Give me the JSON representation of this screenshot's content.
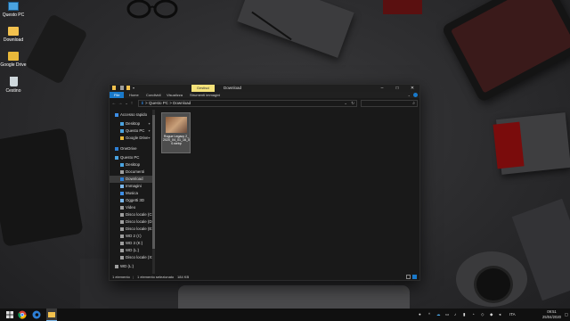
{
  "desktop": {
    "icons": [
      {
        "label": "Questo PC",
        "icon": "computer-icon"
      },
      {
        "label": "Download",
        "icon": "folder-icon"
      },
      {
        "label": "Google Drive",
        "icon": "google-drive-icon"
      },
      {
        "label": "Cestino",
        "icon": "recycle-bin-icon"
      }
    ]
  },
  "window": {
    "title": "Download",
    "context_tab": "Gestisci",
    "ribbon_tabs": [
      "File",
      "Home",
      "Condividi",
      "Visualizza",
      "Strumenti immagini"
    ],
    "address": {
      "parts": [
        "Questo PC",
        "Download"
      ],
      "separator": ">"
    },
    "nav": {
      "items": [
        {
          "label": "Accesso rapido",
          "icon": "star-icon",
          "color": "#3d8ee6",
          "pinned": false
        },
        {
          "label": "Desktop",
          "icon": "desktop-folder-icon",
          "color": "#4aa3e0",
          "pinned": true
        },
        {
          "label": "Questo PC",
          "icon": "computer-icon",
          "color": "#4aa3e0",
          "pinned": true
        },
        {
          "label": "Google Drive",
          "icon": "google-drive-icon",
          "color": "#e8b83a",
          "pinned": true
        },
        {
          "label": "OneDrive",
          "icon": "cloud-icon",
          "color": "#2d7fd6",
          "pinned": false
        },
        {
          "label": "Questo PC",
          "icon": "computer-icon",
          "color": "#4aa3e0",
          "pinned": false
        },
        {
          "label": "Desktop",
          "icon": "desktop-folder-icon",
          "color": "#4aa3e0",
          "pinned": false
        },
        {
          "label": "Documenti",
          "icon": "documents-icon",
          "color": "#9e9e9e",
          "pinned": false
        },
        {
          "label": "Download",
          "icon": "download-icon",
          "color": "#2d7fd6",
          "pinned": false,
          "selected": true
        },
        {
          "label": "Immagini",
          "icon": "pictures-icon",
          "color": "#7bb6e8",
          "pinned": false
        },
        {
          "label": "Musica",
          "icon": "music-icon",
          "color": "#3d8ee6",
          "pinned": false
        },
        {
          "label": "Oggetti 3D",
          "icon": "cube-icon",
          "color": "#7bb6e8",
          "pinned": false
        },
        {
          "label": "Video",
          "icon": "video-icon",
          "color": "#9e9e9e",
          "pinned": false
        },
        {
          "label": "Disco locale (C:)",
          "icon": "drive-icon",
          "color": "#9e9e9e",
          "pinned": false
        },
        {
          "label": "Disco locale (D:)",
          "icon": "drive-icon",
          "color": "#9e9e9e",
          "pinned": false
        },
        {
          "label": "Disco locale (E:)",
          "icon": "drive-icon",
          "color": "#9e9e9e",
          "pinned": false
        },
        {
          "label": "WD 2 (I:)",
          "icon": "drive-icon",
          "color": "#9e9e9e",
          "pinned": false
        },
        {
          "label": "WD 3 (K:)",
          "icon": "drive-icon",
          "color": "#9e9e9e",
          "pinned": false
        },
        {
          "label": "WD (L:)",
          "icon": "drive-icon",
          "color": "#9e9e9e",
          "pinned": false
        },
        {
          "label": "Disco locale (X:)",
          "icon": "drive-icon",
          "color": "#9e9e9e",
          "pinned": false
        },
        {
          "label": "WD (L:)",
          "icon": "drive-icon",
          "color": "#9e9e9e",
          "pinned": false
        }
      ]
    },
    "files": [
      {
        "name": "Rogue Legacy 2_2020_04_01_16_00.webp",
        "icon": "image-file-icon"
      }
    ],
    "status": {
      "count": "1 elemento",
      "selected": "1 elemento selezionato",
      "size": "184 KB"
    }
  },
  "taskbar": {
    "clock_time": "09:51",
    "clock_date": "25/04/2020",
    "language": "ITA"
  },
  "colors": {
    "accent": "#1979ca",
    "context_tab": "#f4e27a",
    "window_bg": "#191919"
  }
}
